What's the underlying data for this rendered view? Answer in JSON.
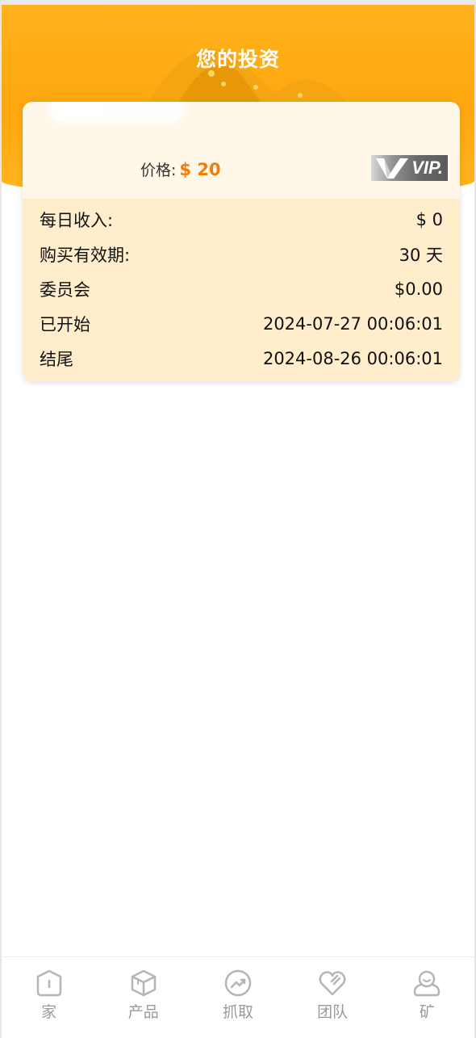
{
  "header": {
    "title": "您的投资"
  },
  "card": {
    "price_label": "价格:",
    "price_value": "$ 20",
    "vip_label": "VIP."
  },
  "details": [
    {
      "label": "每日收入:",
      "value": "$ 0"
    },
    {
      "label": "购买有效期:",
      "value": "30 天"
    },
    {
      "label": "委员会",
      "value": "$0.00"
    },
    {
      "label": "已开始",
      "value": "2024-07-27 00:06:01"
    },
    {
      "label": "结尾",
      "value": "2024-08-26 00:06:01"
    }
  ],
  "nav": [
    {
      "label": "家",
      "icon": "home-icon"
    },
    {
      "label": "产品",
      "icon": "box-icon"
    },
    {
      "label": "抓取",
      "icon": "trend-icon"
    },
    {
      "label": "团队",
      "icon": "heart-icon"
    },
    {
      "label": "矿",
      "icon": "user-icon"
    }
  ],
  "colors": {
    "accent": "#ffa70f",
    "price": "#f07d0a",
    "detail_bg": "#ffedcc",
    "card_bg": "#fff7e8"
  }
}
